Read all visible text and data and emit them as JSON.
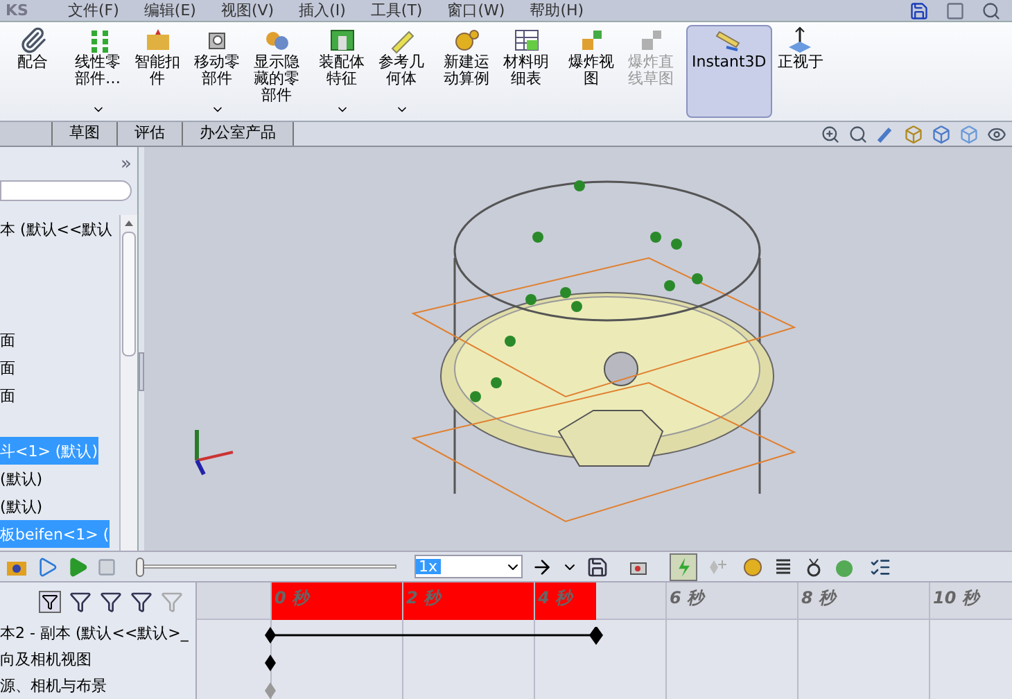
{
  "app_title": "KS",
  "menu": [
    "文件(F)",
    "编辑(E)",
    "视图(V)",
    "插入(I)",
    "工具(T)",
    "窗口(W)",
    "帮助(H)"
  ],
  "ribbon": [
    {
      "label": "配合",
      "kind": "stacked",
      "dropdown": false,
      "disabled": false,
      "selected": false
    },
    {
      "label": "线性零部件…",
      "kind": "stacked",
      "dropdown": true,
      "disabled": false,
      "selected": false
    },
    {
      "label": "智能扣件",
      "kind": "stacked",
      "dropdown": false,
      "disabled": false,
      "selected": false
    },
    {
      "label": "移动零部件",
      "kind": "stacked",
      "dropdown": true,
      "disabled": false,
      "selected": false
    },
    {
      "label": "显示隐藏的零部件",
      "kind": "stacked",
      "dropdown": false,
      "disabled": false,
      "selected": false
    },
    {
      "label": "装配体特征",
      "kind": "stacked",
      "dropdown": true,
      "disabled": false,
      "selected": false
    },
    {
      "label": "参考几何体",
      "kind": "stacked",
      "dropdown": true,
      "disabled": false,
      "selected": false
    },
    {
      "label": "新建运动算例",
      "kind": "stacked",
      "dropdown": false,
      "disabled": false,
      "selected": false
    },
    {
      "label": "材料明细表",
      "kind": "stacked",
      "dropdown": false,
      "disabled": false,
      "selected": false
    },
    {
      "label": "爆炸视图",
      "kind": "stacked",
      "dropdown": false,
      "disabled": false,
      "selected": false
    },
    {
      "label": "爆炸直线草图",
      "kind": "stacked",
      "dropdown": false,
      "disabled": true,
      "selected": false
    },
    {
      "label": "Instant3D",
      "kind": "wide",
      "dropdown": false,
      "disabled": false,
      "selected": true
    },
    {
      "label": "正视于",
      "kind": "wide",
      "dropdown": false,
      "disabled": false,
      "selected": false
    }
  ],
  "tabs": [
    {
      "label": "草图",
      "selected": false
    },
    {
      "label": "评估",
      "selected": false
    },
    {
      "label": "办公室产品",
      "selected": false
    }
  ],
  "tree": {
    "expand_label": "»",
    "items": [
      {
        "label": "本  (默认<<默认",
        "selected": false
      },
      {
        "label": "面",
        "selected": false
      },
      {
        "label": "面",
        "selected": false
      },
      {
        "label": "面",
        "selected": false
      },
      {
        "label": "斗<1> (默认)",
        "selected": true
      },
      {
        "label": " (默认)",
        "selected": false
      },
      {
        "label": " (默认)",
        "selected": false
      },
      {
        "label": "板beifen<1> (",
        "selected": true
      }
    ]
  },
  "playback": {
    "speed": "1x",
    "level": 0
  },
  "timeline": {
    "ticks": [
      "0 秒",
      "2 秒",
      "4 秒",
      "6 秒",
      "8 秒",
      "10 秒"
    ],
    "rows": [
      "本2 - 副本  (默认<<默认>_",
      "向及相机视图",
      "源、相机与布景"
    ]
  }
}
